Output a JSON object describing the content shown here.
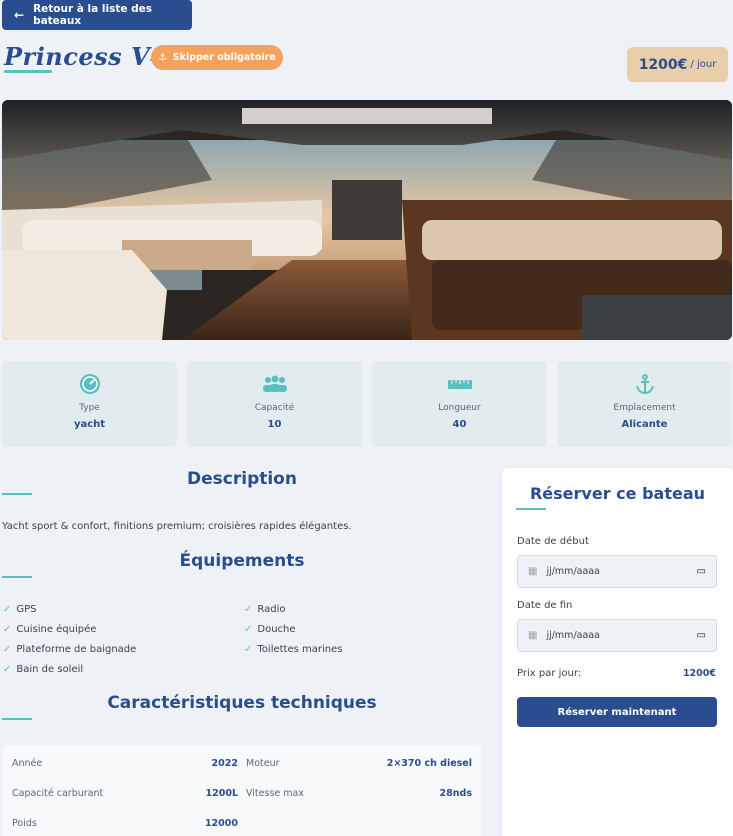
{
  "nav": {
    "back_label": "Retour à la liste des bateaux"
  },
  "boat": {
    "name": "Princess V40",
    "skipper_badge": "Skipper obligatoire",
    "price_amount": "1200€",
    "price_unit": "/ jour"
  },
  "hero_image": {
    "icon": "yacht-interior-photo"
  },
  "stats": [
    {
      "icon": "speedometer-icon",
      "label": "Type",
      "value": "yacht"
    },
    {
      "icon": "users-icon",
      "label": "Capacité",
      "value": "10"
    },
    {
      "icon": "ruler-icon",
      "label": "Longueur",
      "value": "40"
    },
    {
      "icon": "anchor-icon",
      "label": "Emplacement",
      "value": "Alicante"
    }
  ],
  "description": {
    "title": "Description",
    "text": "Yacht sport & confort, finitions premium; croisières rapides élégantes."
  },
  "equipment": {
    "title": "Équipements",
    "items": [
      "GPS",
      "Radio",
      "Cuisine équipée",
      "Douche",
      "Plateforme de baignade",
      "Toilettes marines",
      "Bain de soleil"
    ]
  },
  "specs": {
    "title": "Caractéristiques techniques",
    "rows": [
      {
        "label": "Année",
        "value": "2022"
      },
      {
        "label": "Moteur",
        "value": "2×370 ch diesel"
      },
      {
        "label": "Capacité carburant",
        "value": "1200L"
      },
      {
        "label": "Vitesse max",
        "value": "28nds"
      },
      {
        "label": "Poids",
        "value": "12000"
      }
    ]
  },
  "booking": {
    "title": "Réserver ce bateau",
    "start_label": "Date de début",
    "start_placeholder": "jj/mm/aaaa",
    "end_label": "Date de fin",
    "end_placeholder": "jj/mm/aaaa",
    "price_label": "Prix par jour:",
    "price_value": "1200€",
    "button_label": "Réserver maintenant"
  },
  "colors": {
    "primary": "#2a4d8f",
    "accent": "#5bbfc0",
    "badge": "#f5a35c",
    "price_bg": "#e8cfaa"
  }
}
